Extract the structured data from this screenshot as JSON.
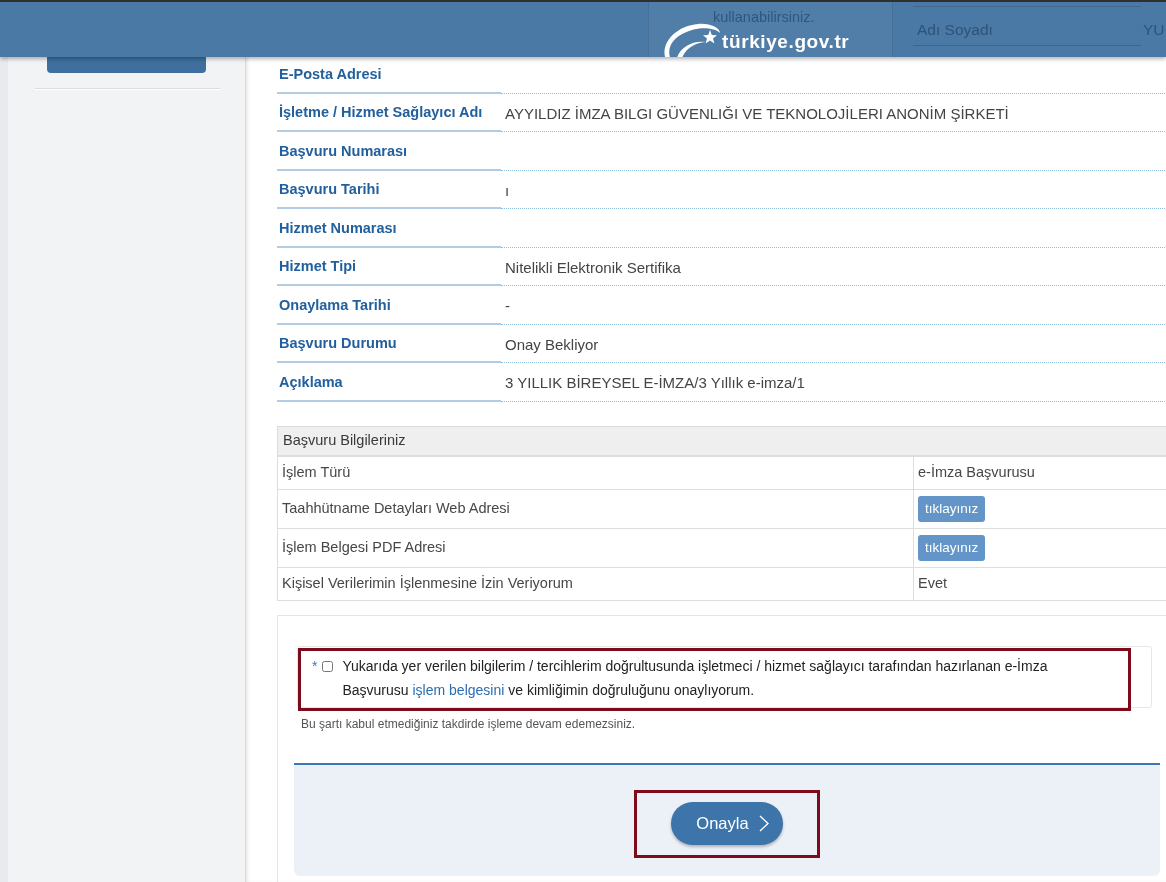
{
  "header": {
    "notice_text": "kullanabilirsiniz.",
    "logo_text": "türkiye.gov.tr",
    "user_column_label": "Adı Soyadı",
    "user_name": "YU"
  },
  "details": [
    {
      "label": "E-Posta Adresi"
    },
    {
      "label": "İşletme / Hizmet Sağlayıcı Adı",
      "value": "AYYILDIZ İMZA BILGI GÜVENLIĞI VE TEKNOLOJİLERI ANONİM ŞİRKETİ"
    },
    {
      "label": "Başvuru Numarası"
    },
    {
      "label": "Başvuru Tarihi",
      "value": "ı"
    },
    {
      "label": "Hizmet Numarası"
    },
    {
      "label": "Hizmet Tipi",
      "value": "Nitelikli Elektronik Sertifika"
    },
    {
      "label": "Onaylama Tarihi",
      "value": "-"
    },
    {
      "label": "Başvuru Durumu",
      "value": "Onay Bekliyor"
    },
    {
      "label": "Açıklama",
      "value": "3 YILLIK BİREYSEL E-İMZA/3 Yıllık e-imza/1"
    }
  ],
  "application_info": {
    "title": "Başvuru Bilgileriniz",
    "rows": [
      {
        "label": "İşlem Türü",
        "kind": "text",
        "value": "e-İmza Başvurusu"
      },
      {
        "label": "Taahhütname Detayları Web Adresi",
        "kind": "button",
        "value": "tıklayınız"
      },
      {
        "label": "İşlem Belgesi PDF Adresi",
        "kind": "button",
        "value": "tıklayınız"
      },
      {
        "label": "Kişisel Verilerimin İşlenmesine İzin Veriyorum",
        "kind": "text",
        "value": "Evet"
      }
    ]
  },
  "consent": {
    "required_mark": "*",
    "checked": false,
    "text_before": "Yukarıda yer verilen bilgilerim / tercihlerim doğrultusunda işletmeci / hizmet sağlayıcı tarafından hazırlanan e-İmza Başvurusu",
    "link": "işlem belgesini",
    "text_after": "ve kimliğimin doğruluğunu onaylıyorum.",
    "highlighted": true,
    "hint": "Bu şartı kabul etmediğiniz takdirde işleme devam edemezsiniz."
  },
  "confirm_button": {
    "label": "Onayla",
    "highlighted": true
  }
}
